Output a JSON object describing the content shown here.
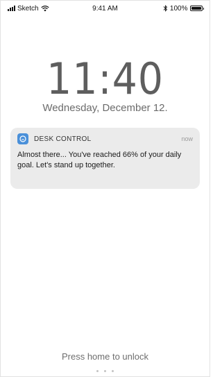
{
  "status_bar": {
    "carrier": "Sketch",
    "time": "9:41 AM",
    "battery_percent": "100%",
    "battery_level": 1.0,
    "icons": [
      "signal-icon",
      "wifi-icon",
      "bluetooth-icon",
      "battery-icon"
    ]
  },
  "lock_screen": {
    "clock": "11:40",
    "date": "Wednesday, December 12."
  },
  "notification": {
    "app_name": "DESK CONTROL",
    "time": "now",
    "message": "Almost there... You've reached 66% of your daily goal. Let's stand up together.",
    "app_icon": "desk-control-app-icon",
    "accent_color": "#4a90d9"
  },
  "footer": {
    "unlock_hint": "Press home to unlock",
    "page_count": 3
  }
}
